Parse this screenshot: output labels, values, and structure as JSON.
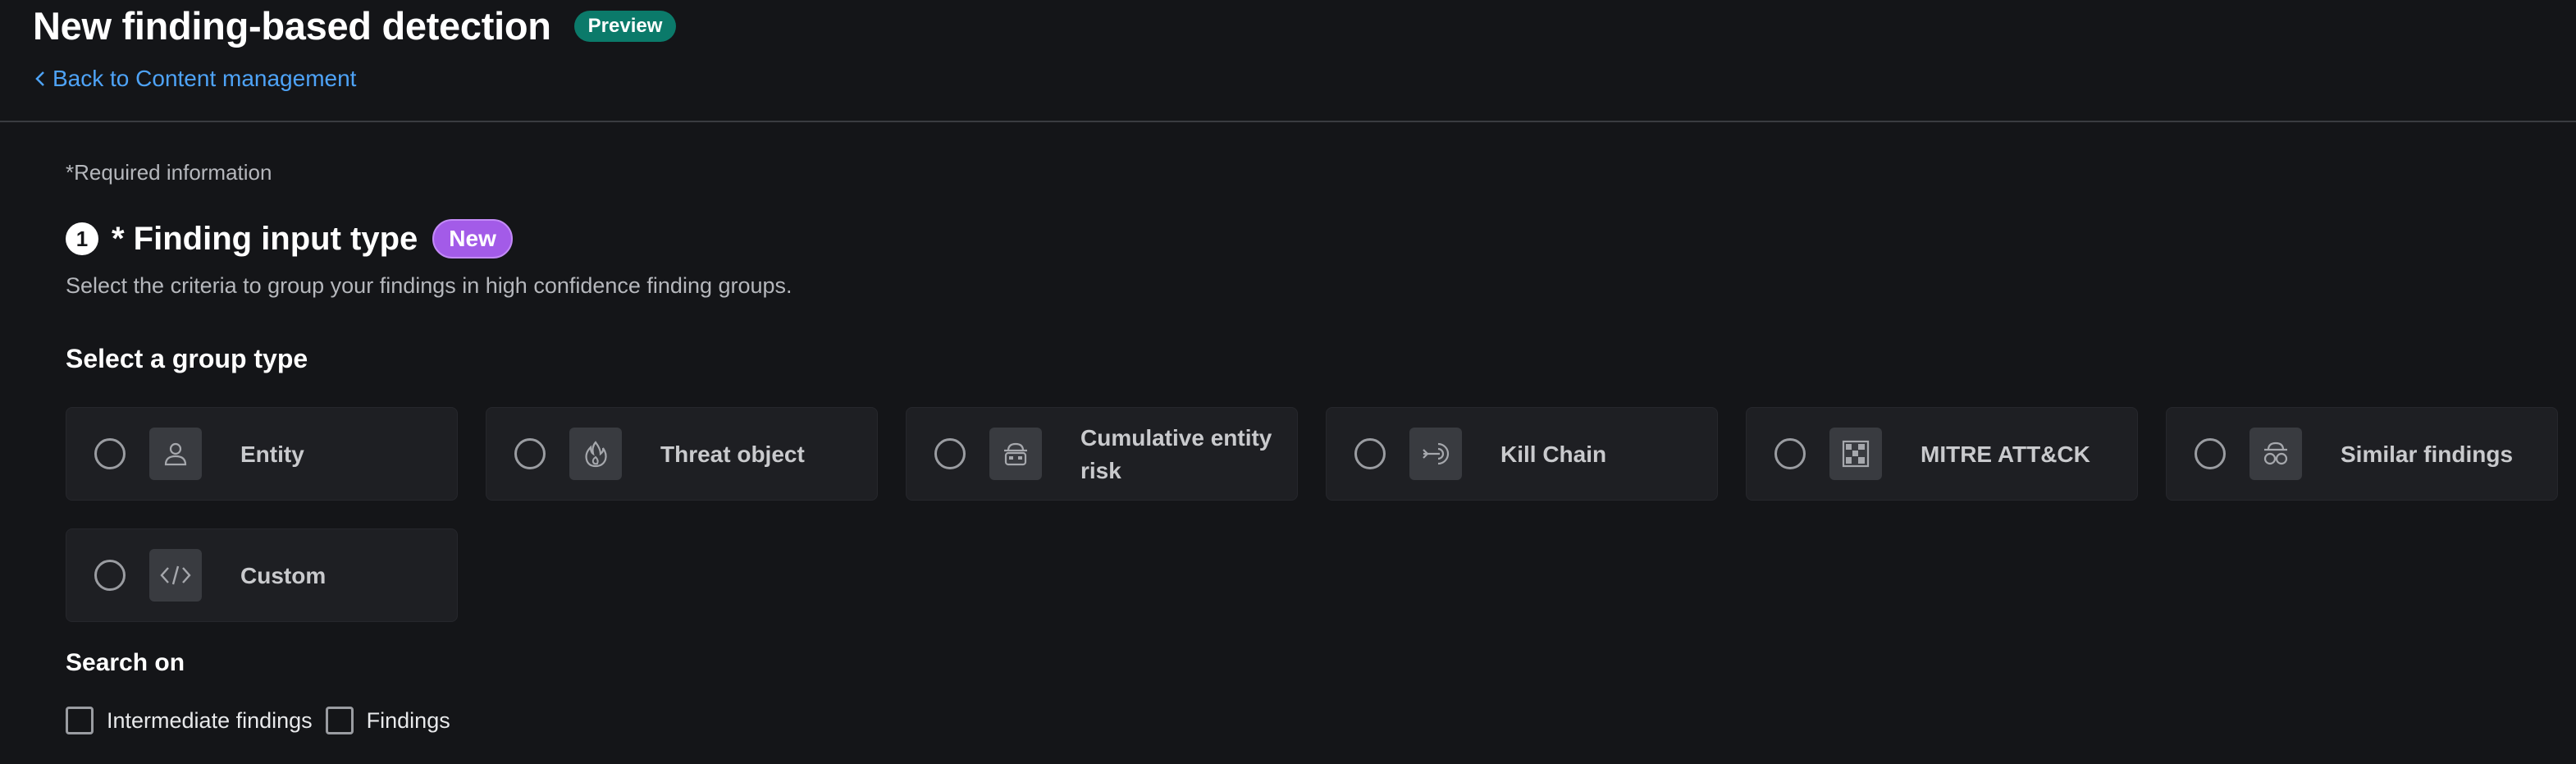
{
  "header": {
    "title": "New finding-based detection",
    "badge": "Preview",
    "back_link": "Back to Content management"
  },
  "form": {
    "required_note": "*Required information",
    "section": {
      "number": "1",
      "title": "* Finding input type",
      "badge": "New",
      "description": "Select the criteria to group your findings in high confidence finding groups."
    },
    "group_type_label": "Select a group type",
    "group_types": [
      {
        "label": "Entity",
        "icon": "person-icon"
      },
      {
        "label": "Threat object",
        "icon": "fire-icon"
      },
      {
        "label": "Cumulative entity risk",
        "icon": "robber-mask-icon"
      },
      {
        "label": "Kill Chain",
        "icon": "target-arrow-icon"
      },
      {
        "label": "MITRE ATT&CK",
        "icon": "matrix-grid-icon"
      },
      {
        "label": "Similar findings",
        "icon": "spy-icon"
      },
      {
        "label": "Custom",
        "icon": "code-icon"
      }
    ],
    "search_on_label": "Search on",
    "search_options": [
      "Intermediate findings",
      "Findings"
    ]
  },
  "colors": {
    "background": "#141518",
    "card": "#1e1f23",
    "accent_link": "#4ea3f7",
    "preview_badge": "#0b7a6a",
    "new_badge": "#a35be8"
  }
}
